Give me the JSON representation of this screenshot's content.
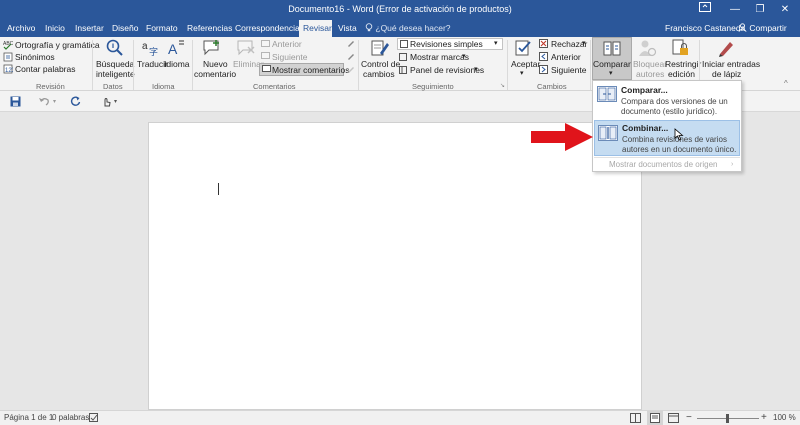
{
  "window": {
    "title": "Documento16 - Word (Error de activación de productos)",
    "minimize_glyph": "—",
    "restore_glyph": "❐",
    "close_glyph": "✕"
  },
  "tabs": {
    "archivo": "Archivo",
    "inicio": "Inicio",
    "insertar": "Insertar",
    "diseno": "Diseño",
    "formato": "Formato",
    "referencias": "Referencias",
    "correspondencia": "Correspondencia",
    "revisar": "Revisar",
    "vista": "Vista",
    "tell_me": "¿Qué desea hacer?",
    "user": "Francisco Castaneda",
    "share": "Compartir"
  },
  "ribbon": {
    "revision": {
      "ortografia": "Ortografía y gramática",
      "sinonimos": "Sinónimos",
      "contar": "Contar palabras",
      "group": "Revisión"
    },
    "datos": {
      "busqueda_l1": "Búsqueda",
      "busqueda_l2": "inteligente",
      "group": "Datos"
    },
    "idioma": {
      "traducir": "Traducir",
      "idioma": "Idioma",
      "group": "Idioma"
    },
    "comentarios": {
      "nuevo_l1": "Nuevo",
      "nuevo_l2": "comentario",
      "eliminar": "Eliminar",
      "anterior": "Anterior",
      "siguiente": "Siguiente",
      "mostrar": "Mostrar comentarios",
      "group": "Comentarios"
    },
    "seguimiento": {
      "control_l1": "Control de",
      "control_l2": "cambios",
      "revisiones": "Revisiones simples",
      "mostrar_marcas": "Mostrar marcas",
      "panel": "Panel de revisiones",
      "group": "Seguimiento"
    },
    "cambios": {
      "aceptar": "Aceptar",
      "rechazar": "Rechazar",
      "anterior": "Anterior",
      "siguiente": "Siguiente",
      "group": "Cambios"
    },
    "comparar": {
      "label": "Comparar"
    },
    "proteger": {
      "bloquear_l1": "Bloquear",
      "bloquear_l2": "autores",
      "restringir_l1": "Restringir",
      "restringir_l2": "edición"
    },
    "lapiz": {
      "iniciar_l1": "Iniciar entradas",
      "iniciar_l2": "de lápiz"
    }
  },
  "compare_menu": {
    "comparar_title": "Comparar...",
    "comparar_desc_1": "Compara dos versiones de un",
    "comparar_desc_2": "documento (estilo jurídico).",
    "combinar_title": "Combinar...",
    "combinar_desc_1": "Combina revisiones de varios",
    "combinar_desc_2": "autores en un documento único.",
    "mostrar_origen": "Mostrar documentos de origen"
  },
  "status": {
    "page": "Página 1 de 1",
    "words": "0 palabras",
    "zoom": "100 %",
    "zoom_minus": "−",
    "zoom_plus": "+"
  },
  "colors": {
    "word_blue": "#2b579a",
    "highlight": "#c5dcf1",
    "arrow_red": "#e0141b"
  }
}
